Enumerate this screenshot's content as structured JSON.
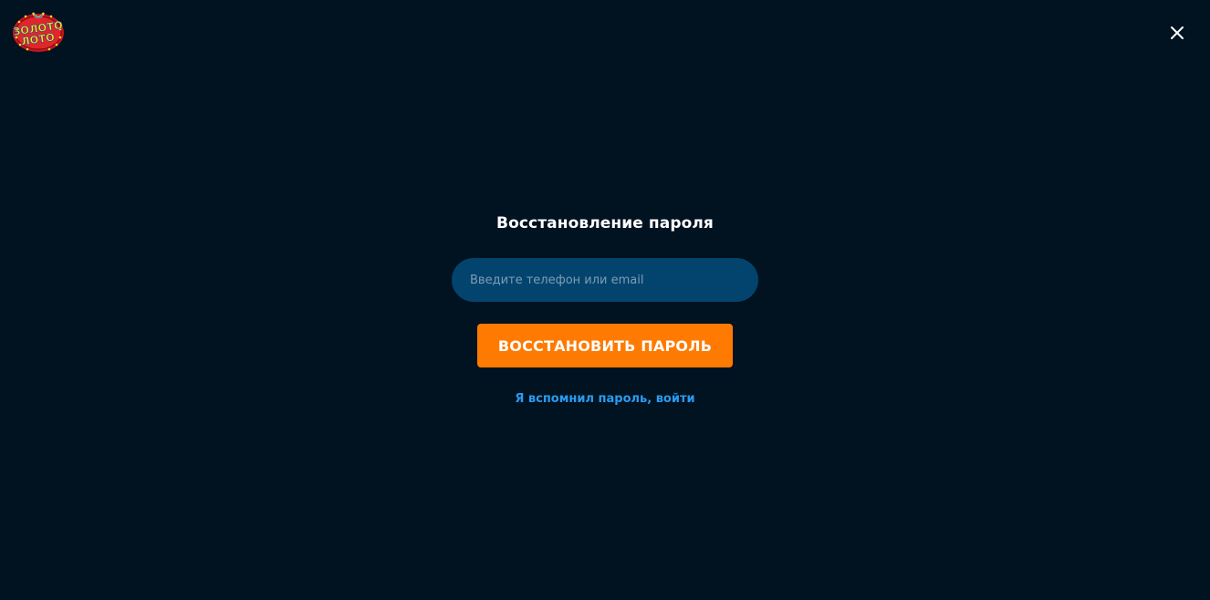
{
  "header": {
    "logo_text": "ЗОЛОТО ЛОТО",
    "logo_line1": "ЗОЛОТО",
    "logo_line2": "ЛОТО",
    "close_icon": "close-icon"
  },
  "form": {
    "title": "Восстановление пароля",
    "input_placeholder": "Введите телефон или email",
    "input_value": "",
    "submit_label": "ВОССТАНОВИТЬ ПАРОЛЬ",
    "login_link": "Я вспомнил пароль, войти"
  },
  "colors": {
    "background": "#011321",
    "input_bg": "#03446f",
    "accent": "#ff7a00",
    "link": "#2a9bef",
    "logo_red": "#d61a1a",
    "logo_yellow": "#ffe600"
  }
}
